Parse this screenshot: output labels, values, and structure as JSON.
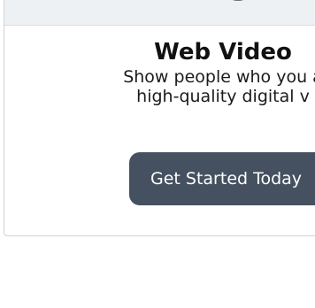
{
  "card": {
    "title": "Web Video",
    "description_line1": "Show people who you a",
    "description_line2": "high-quality digital v",
    "cta_label": "Get Started Today",
    "icon": "play-icon"
  },
  "colors": {
    "button_bg": "#455160",
    "button_text": "#ffffff",
    "card_border": "#cfd3d7",
    "card_header_bg": "#eef1f4",
    "title_text": "#111111"
  }
}
